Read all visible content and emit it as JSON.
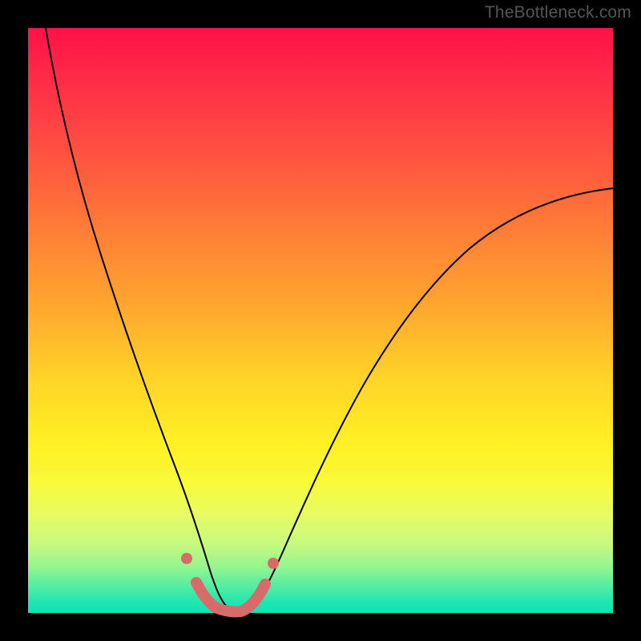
{
  "watermark": "TheBottleneck.com",
  "colors": {
    "background": "#000000",
    "gradient_top": "#ff1149",
    "gradient_mid": "#fff023",
    "gradient_bottom": "#0de3b6",
    "curve": "#000000",
    "marker": "#d96a6a"
  },
  "chart_data": {
    "type": "line",
    "title": "",
    "xlabel": "",
    "ylabel": "",
    "xlim": [
      0,
      100
    ],
    "ylim": [
      0,
      100
    ],
    "grid": false,
    "series": [
      {
        "name": "bottleneck-curve",
        "x": [
          3,
          6,
          10,
          14,
          18,
          22,
          26,
          28,
          30,
          32,
          34,
          36,
          38,
          40,
          44,
          50,
          56,
          62,
          70,
          80,
          90,
          100
        ],
        "y": [
          100,
          86,
          70,
          56,
          42,
          30,
          18,
          12,
          6,
          2,
          0,
          0,
          0,
          2,
          8,
          20,
          32,
          42,
          52,
          62,
          68,
          70
        ]
      }
    ],
    "markers": {
      "name": "bottom-band",
      "x": [
        27.5,
        29,
        31,
        33,
        35,
        37,
        39,
        40.5
      ],
      "y": [
        10,
        5,
        1,
        0,
        0,
        1,
        5,
        10
      ]
    }
  }
}
